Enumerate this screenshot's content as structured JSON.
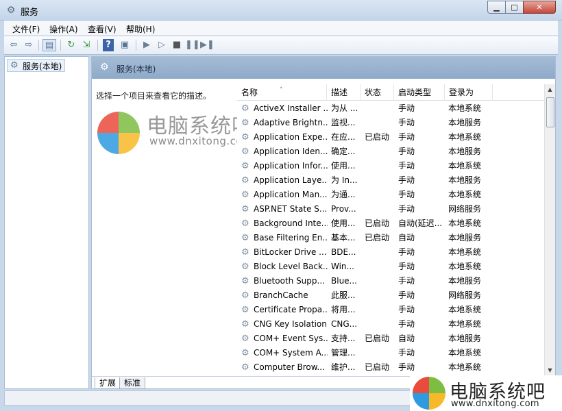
{
  "window": {
    "title": "服务",
    "min_icon": "minimize-icon",
    "max_icon": "maximize-icon",
    "close_icon": "close-icon"
  },
  "menu": [
    "文件(F)",
    "操作(A)",
    "查看(V)",
    "帮助(H)"
  ],
  "toolbar": {
    "icons": [
      "back-arrow-icon",
      "forward-arrow-icon",
      "console-tree-icon",
      "refresh-icon",
      "export-list-icon",
      "help-icon",
      "properties-icon",
      "start-service-icon",
      "start-service-alt-icon",
      "stop-service-icon",
      "pause-service-icon",
      "restart-service-icon"
    ]
  },
  "tree": {
    "node_label": "服务(本地)"
  },
  "panel": {
    "header": "服务(本地)",
    "description_prompt": "选择一个项目来查看它的描述。"
  },
  "columns": {
    "name": "名称",
    "desc": "描述",
    "status": "状态",
    "startup": "启动类型",
    "logon": "登录为"
  },
  "services": [
    {
      "name": "ActiveX Installer ...",
      "desc": "为从 ...",
      "status": "",
      "startup": "手动",
      "logon": "本地系统"
    },
    {
      "name": "Adaptive Brightn...",
      "desc": "监视...",
      "status": "",
      "startup": "手动",
      "logon": "本地服务"
    },
    {
      "name": "Application Expe...",
      "desc": "在应...",
      "status": "已启动",
      "startup": "手动",
      "logon": "本地系统"
    },
    {
      "name": "Application Iden...",
      "desc": "确定...",
      "status": "",
      "startup": "手动",
      "logon": "本地服务"
    },
    {
      "name": "Application Infor...",
      "desc": "使用...",
      "status": "",
      "startup": "手动",
      "logon": "本地系统"
    },
    {
      "name": "Application Laye...",
      "desc": "为 In...",
      "status": "",
      "startup": "手动",
      "logon": "本地服务"
    },
    {
      "name": "Application Man...",
      "desc": "为通...",
      "status": "",
      "startup": "手动",
      "logon": "本地系统"
    },
    {
      "name": "ASP.NET State S...",
      "desc": "Prov...",
      "status": "",
      "startup": "手动",
      "logon": "网络服务"
    },
    {
      "name": "Background Inte...",
      "desc": "使用...",
      "status": "已启动",
      "startup": "自动(延迟...",
      "logon": "本地系统"
    },
    {
      "name": "Base Filtering En...",
      "desc": "基本...",
      "status": "已启动",
      "startup": "自动",
      "logon": "本地服务"
    },
    {
      "name": "BitLocker Drive ...",
      "desc": "BDE...",
      "status": "",
      "startup": "手动",
      "logon": "本地系统"
    },
    {
      "name": "Block Level Back...",
      "desc": "Win...",
      "status": "",
      "startup": "手动",
      "logon": "本地系统"
    },
    {
      "name": "Bluetooth Supp...",
      "desc": "Blue...",
      "status": "",
      "startup": "手动",
      "logon": "本地服务"
    },
    {
      "name": "BranchCache",
      "desc": "此服...",
      "status": "",
      "startup": "手动",
      "logon": "网络服务"
    },
    {
      "name": "Certificate Propa...",
      "desc": "将用...",
      "status": "",
      "startup": "手动",
      "logon": "本地系统"
    },
    {
      "name": "CNG Key Isolation",
      "desc": "CNG...",
      "status": "",
      "startup": "手动",
      "logon": "本地系统"
    },
    {
      "name": "COM+ Event Sys...",
      "desc": "支持...",
      "status": "已启动",
      "startup": "自动",
      "logon": "本地服务"
    },
    {
      "name": "COM+ System A...",
      "desc": "管理...",
      "status": "",
      "startup": "手动",
      "logon": "本地系统"
    },
    {
      "name": "Computer Brow...",
      "desc": "维护...",
      "status": "已启动",
      "startup": "手动",
      "logon": "本地系统"
    }
  ],
  "tabs": [
    "扩展",
    "标准"
  ],
  "watermark": {
    "title": "电脑系统吧",
    "url": "www.dnxitong.com",
    "colors": [
      "#e94b3c",
      "#7cbd42",
      "#2e9be0",
      "#f7b928"
    ]
  }
}
